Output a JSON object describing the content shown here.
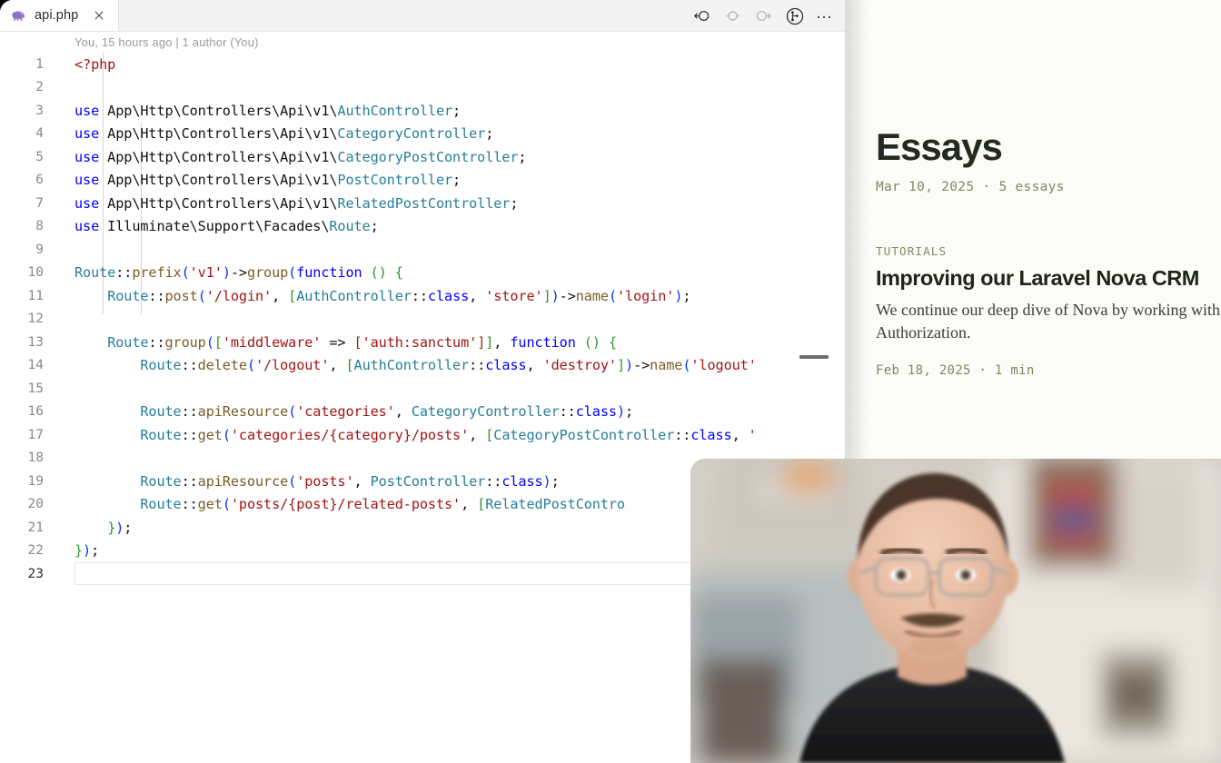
{
  "editor": {
    "tab": {
      "label": "api.php",
      "icon": "php-elephant-icon",
      "close_icon": "close-icon"
    },
    "actions": [
      {
        "name": "split-editor-left-icon",
        "label": ""
      },
      {
        "name": "navigate-back-icon",
        "label": ""
      },
      {
        "name": "navigate-forward-icon",
        "label": ""
      },
      {
        "name": "source-control-graph-icon",
        "label": ""
      },
      {
        "name": "more-actions-icon",
        "label": "…"
      }
    ],
    "blame": "You, 15 hours ago | 1 author (You)",
    "current_line": 23,
    "lines": [
      {
        "n": "1",
        "text": "<?php"
      },
      {
        "n": "2",
        "text": ""
      },
      {
        "n": "3",
        "text": "use App\\Http\\Controllers\\Api\\v1\\AuthController;"
      },
      {
        "n": "4",
        "text": "use App\\Http\\Controllers\\Api\\v1\\CategoryController;"
      },
      {
        "n": "5",
        "text": "use App\\Http\\Controllers\\Api\\v1\\CategoryPostController;"
      },
      {
        "n": "6",
        "text": "use App\\Http\\Controllers\\Api\\v1\\PostController;"
      },
      {
        "n": "7",
        "text": "use App\\Http\\Controllers\\Api\\v1\\RelatedPostController;"
      },
      {
        "n": "8",
        "text": "use Illuminate\\Support\\Facades\\Route;"
      },
      {
        "n": "9",
        "text": ""
      },
      {
        "n": "10",
        "text": "Route::prefix('v1')->group(function () {"
      },
      {
        "n": "11",
        "text": "    Route::post('/login', [AuthController::class, 'store'])->name('login');"
      },
      {
        "n": "12",
        "text": ""
      },
      {
        "n": "13",
        "text": "    Route::group(['middleware' => ['auth:sanctum']], function () {"
      },
      {
        "n": "14",
        "text": "        Route::delete('/logout', [AuthController::class, 'destroy'])->name('logout'"
      },
      {
        "n": "15",
        "text": ""
      },
      {
        "n": "16",
        "text": "        Route::apiResource('categories', CategoryController::class);"
      },
      {
        "n": "17",
        "text": "        Route::get('categories/{category}/posts', [CategoryPostController::class, '"
      },
      {
        "n": "18",
        "text": ""
      },
      {
        "n": "19",
        "text": "        Route::apiResource('posts', PostController::class);"
      },
      {
        "n": "20",
        "text": "        Route::get('posts/{post}/related-posts', [RelatedPostContro"
      },
      {
        "n": "21",
        "text": "    });"
      },
      {
        "n": "22",
        "text": "});"
      },
      {
        "n": "23",
        "text": ""
      }
    ]
  },
  "site": {
    "heading": "Essays",
    "meta": "Mar 10, 2025 · 5 essays",
    "posts": [
      {
        "category": "TUTORIALS",
        "title": "Improving our Laravel Nova CRM",
        "description": "We continue our deep dive of Nova by working with and Authorization.",
        "date": "Feb 18, 2025 · 1 min"
      }
    ]
  },
  "webcam": {
    "name": "webcam-overlay",
    "subject": "presenter"
  },
  "colors": {
    "keyword": "#0000ff",
    "class_name": "#267f99",
    "string": "#a31515",
    "method": "#795e26",
    "site_accent": "#7e8a63",
    "php_icon": "#8f76c4"
  }
}
